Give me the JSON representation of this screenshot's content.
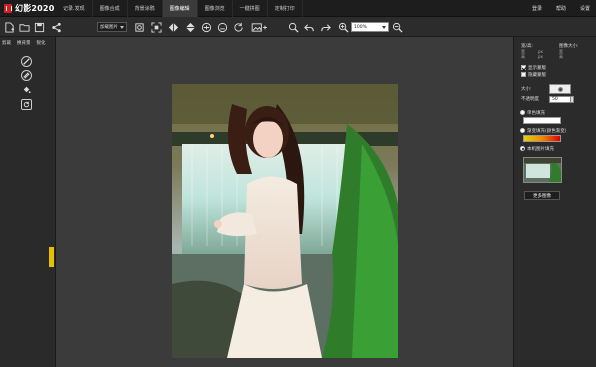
{
  "app": {
    "title": "幻影2020"
  },
  "menu_tabs": [
    {
      "label": "记录.发现"
    },
    {
      "label": "图像合成"
    },
    {
      "label": "背景涂鸦"
    },
    {
      "label": "图像编辑"
    },
    {
      "label": "图像浏览"
    },
    {
      "label": "一键拼图"
    },
    {
      "label": "定制打印"
    }
  ],
  "active_tab_index": 3,
  "top_right": {
    "login": "登录",
    "help": "帮助",
    "settings": "设置"
  },
  "toolbar": {
    "load_image_select": "加载图片",
    "zoom_value": "100%"
  },
  "left_panel": {
    "tabs": [
      "剪裁",
      "换背景",
      "锐化"
    ]
  },
  "right_panel": {
    "width_label": "宽/高:",
    "image_size_label": "图像大小:",
    "w_label": "宽",
    "h_label": "高",
    "px_label": "px",
    "show_mask": "显示蒙版",
    "hide_mask": "隐藏蒙版",
    "size_label": "大小:",
    "opacity_label": "不透明度",
    "opacity_value": "50",
    "single_color_fill": "单色填充",
    "gradient_fill": "渐变填充(颜色渐变)",
    "local_image_fill": "本机图片填充",
    "more_images_button": "更多图像"
  },
  "colors": {
    "accent_yellow": "#e4c100",
    "logo_red": "#d21e1e",
    "bg_dark": "#1d1d1d"
  }
}
